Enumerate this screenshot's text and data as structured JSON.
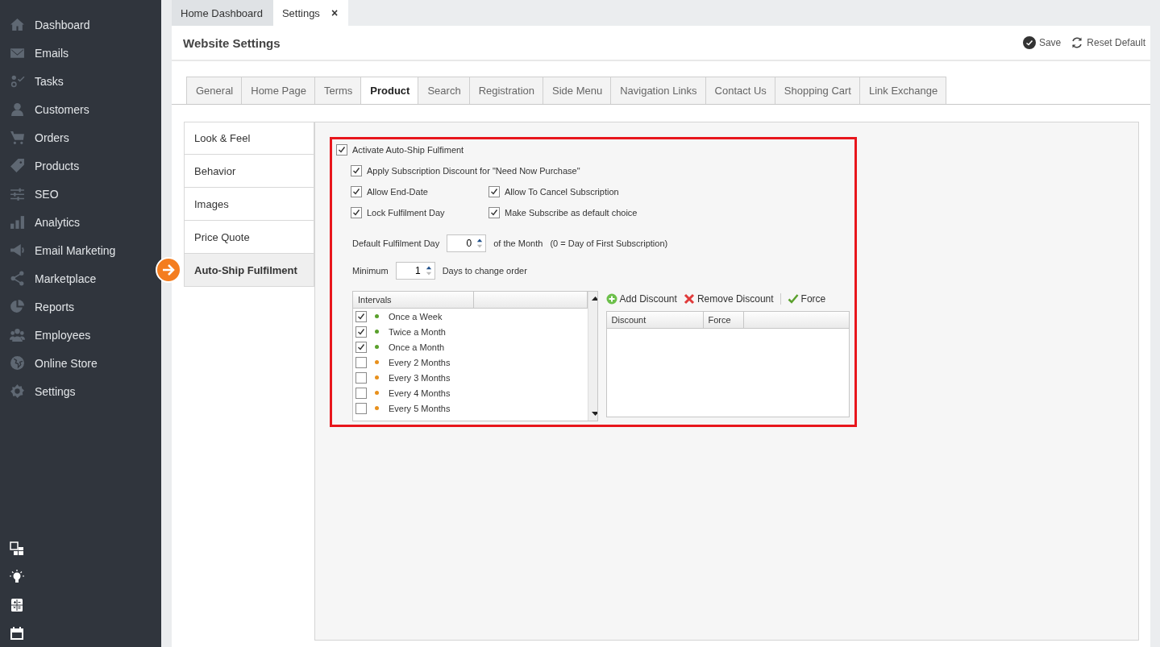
{
  "sidebar": {
    "items": [
      {
        "label": "Dashboard"
      },
      {
        "label": "Emails"
      },
      {
        "label": "Tasks"
      },
      {
        "label": "Customers"
      },
      {
        "label": "Orders"
      },
      {
        "label": "Products"
      },
      {
        "label": "SEO"
      },
      {
        "label": "Analytics"
      },
      {
        "label": "Email Marketing"
      },
      {
        "label": "Marketplace"
      },
      {
        "label": "Reports"
      },
      {
        "label": "Employees"
      },
      {
        "label": "Online Store"
      },
      {
        "label": "Settings"
      }
    ]
  },
  "doc_tabs": [
    {
      "label": "Home Dashboard",
      "selected": false
    },
    {
      "label": "Settings",
      "selected": true,
      "close": "×"
    }
  ],
  "page": {
    "title": "Website Settings",
    "actions": [
      {
        "label": "Save",
        "kind": "save"
      },
      {
        "label": "Reset Default",
        "kind": "reset"
      }
    ]
  },
  "settings_tabs": [
    {
      "label": "General",
      "selected": false
    },
    {
      "label": "Home Page",
      "selected": false
    },
    {
      "label": "Terms",
      "selected": false
    },
    {
      "label": "Product",
      "selected": true
    },
    {
      "label": "Search",
      "selected": false
    },
    {
      "label": "Registration",
      "selected": false
    },
    {
      "label": "Side Menu",
      "selected": false
    },
    {
      "label": "Navigation Links",
      "selected": false
    },
    {
      "label": "Contact Us",
      "selected": false
    },
    {
      "label": "Shopping Cart",
      "selected": false
    },
    {
      "label": "Link Exchange",
      "selected": false
    }
  ],
  "sections": [
    {
      "label": "Look & Feel",
      "selected": false
    },
    {
      "label": "Behavior",
      "selected": false
    },
    {
      "label": "Images",
      "selected": false
    },
    {
      "label": "Price Quote",
      "selected": false
    },
    {
      "label": "Auto-Ship Fulfilment",
      "selected": true
    }
  ],
  "auto_ship": {
    "activate": {
      "label": "Activate Auto-Ship Fulfiment",
      "checked": true
    },
    "options": [
      {
        "label": "Apply Subscription Discount for \"Need Now Purchase\"",
        "checked": true
      }
    ],
    "option_grid": [
      {
        "label": "Allow End-Date",
        "checked": true
      },
      {
        "label": "Allow To Cancel Subscription",
        "checked": true
      },
      {
        "label": "Lock Fulfilment Day",
        "checked": true
      },
      {
        "label": "Make Subscribe as default choice",
        "checked": true
      }
    ],
    "default_day": {
      "label": "Default Fulfilment Day",
      "value": "0",
      "suffix": "of the Month",
      "note": "(0 = Day of First Subscription)"
    },
    "minimum": {
      "label": "Minimum",
      "value": "1",
      "suffix": "Days to change order"
    },
    "intervals": {
      "columns": [
        "Intervals"
      ],
      "rows": [
        {
          "label": "Once a Week",
          "checked": true,
          "color": "#5aa02c"
        },
        {
          "label": "Twice a Month",
          "checked": true,
          "color": "#5aa02c"
        },
        {
          "label": "Once a Month",
          "checked": true,
          "color": "#5aa02c"
        },
        {
          "label": "Every 2 Months",
          "checked": false,
          "color": "#e8901c"
        },
        {
          "label": "Every 3 Months",
          "checked": false,
          "color": "#e8901c"
        },
        {
          "label": "Every 4 Months",
          "checked": false,
          "color": "#e8901c"
        },
        {
          "label": "Every 5 Months",
          "checked": false,
          "color": "#e8901c"
        }
      ]
    },
    "discount_toolbar": [
      {
        "label": "Add Discount",
        "kind": "add"
      },
      {
        "label": "Remove Discount",
        "kind": "remove"
      },
      {
        "label": "Force",
        "kind": "force"
      }
    ],
    "discount_table": {
      "columns": [
        "Discount",
        "Force"
      ]
    }
  }
}
